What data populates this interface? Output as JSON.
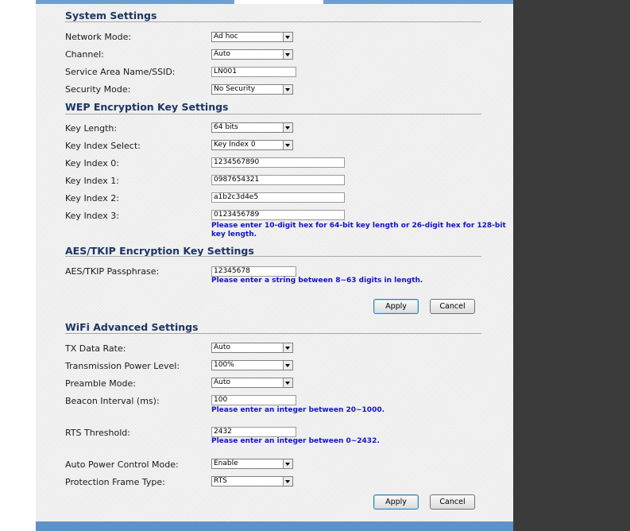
{
  "sections": {
    "system": "System Settings",
    "wep": "WEP Encryption Key Settings",
    "aes": "AES/TKIP Encryption Key Settings",
    "wifi": "WiFi Advanced Settings"
  },
  "system": {
    "network_mode": {
      "label": "Network Mode:",
      "value": "Ad hoc"
    },
    "channel": {
      "label": "Channel:",
      "value": "Auto"
    },
    "ssid": {
      "label": "Service Area Name/SSID:",
      "value": "LN001"
    },
    "security_mode": {
      "label": "Security Mode:",
      "value": "No Security"
    }
  },
  "wep": {
    "key_length": {
      "label": "Key Length:",
      "value": "64 bits"
    },
    "key_index_select": {
      "label": "Key Index Select:",
      "value": "Key Index 0"
    },
    "key0": {
      "label": "Key Index 0:",
      "value": "1234567890"
    },
    "key1": {
      "label": "Key Index 1:",
      "value": "0987654321"
    },
    "key2": {
      "label": "Key Index 2:",
      "value": "a1b2c3d4e5"
    },
    "key3": {
      "label": "Key Index 3:",
      "value": "0123456789"
    },
    "hint_line1": "Please enter 10-digit hex for 64-bit key length or 26-digit hex for 128-bit",
    "hint_line2": "key length."
  },
  "aes": {
    "passphrase": {
      "label": "AES/TKIP Passphrase:",
      "value": "12345678"
    },
    "hint": "Please enter a string between 8~63 digits in length."
  },
  "wifi": {
    "tx_rate": {
      "label": "TX Data Rate:",
      "value": "Auto"
    },
    "power_level": {
      "label": "Transmission Power Level:",
      "value": "100%"
    },
    "preamble": {
      "label": "Preamble Mode:",
      "value": "Auto"
    },
    "beacon": {
      "label": "Beacon Interval (ms):",
      "value": "100"
    },
    "beacon_hint": "Please enter an integer between 20~1000.",
    "rts": {
      "label": "RTS Threshold:",
      "value": "2432"
    },
    "rts_hint": "Please enter an integer between 0~2432.",
    "auto_power": {
      "label": "Auto Power Control Mode:",
      "value": "Enable"
    },
    "protection": {
      "label": "Protection Frame Type:",
      "value": "RTS"
    }
  },
  "buttons": {
    "apply": "Apply",
    "cancel": "Cancel"
  }
}
